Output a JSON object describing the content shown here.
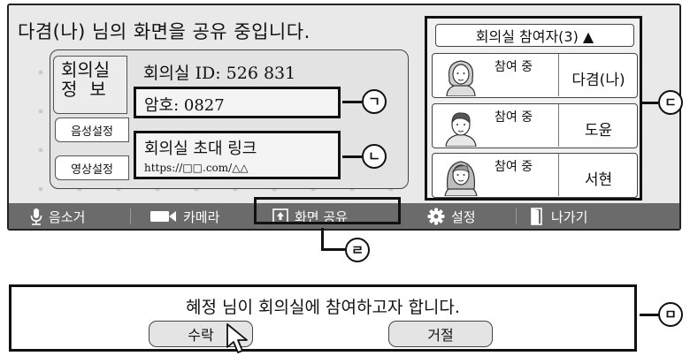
{
  "screen": {
    "share_status": "다겸(나) 님의 화면을 공유 중입니다."
  },
  "info_panel": {
    "tab_title_line1": "회의실",
    "tab_title_line2": "정보",
    "tab_audio": "음성설정",
    "tab_video": "영상설정",
    "room_id": "회의실 ID: 526 831",
    "password": "암호: 0827",
    "invite_title": "회의실 초대 링크",
    "invite_url": "https://□□.com/△△"
  },
  "participants": {
    "header": "회의실 참여자(3) ▲",
    "list": [
      {
        "status": "참여 중",
        "name": "다겸(나)"
      },
      {
        "status": "참여 중",
        "name": "도윤"
      },
      {
        "status": "참여 중",
        "name": "서현"
      }
    ]
  },
  "toolbar": {
    "mute": "음소거",
    "camera": "카메라",
    "share_screen": "화면 공유",
    "settings": "설정",
    "leave": "나가기"
  },
  "dialog": {
    "message": "혜정 님이 회의실에 참여하고자 합니다.",
    "accept": "수락",
    "reject": "거절"
  },
  "labels": {
    "a": "ㄱ",
    "b": "ㄴ",
    "c": "ㄷ",
    "d": "ㄹ",
    "e": "ㅁ"
  }
}
